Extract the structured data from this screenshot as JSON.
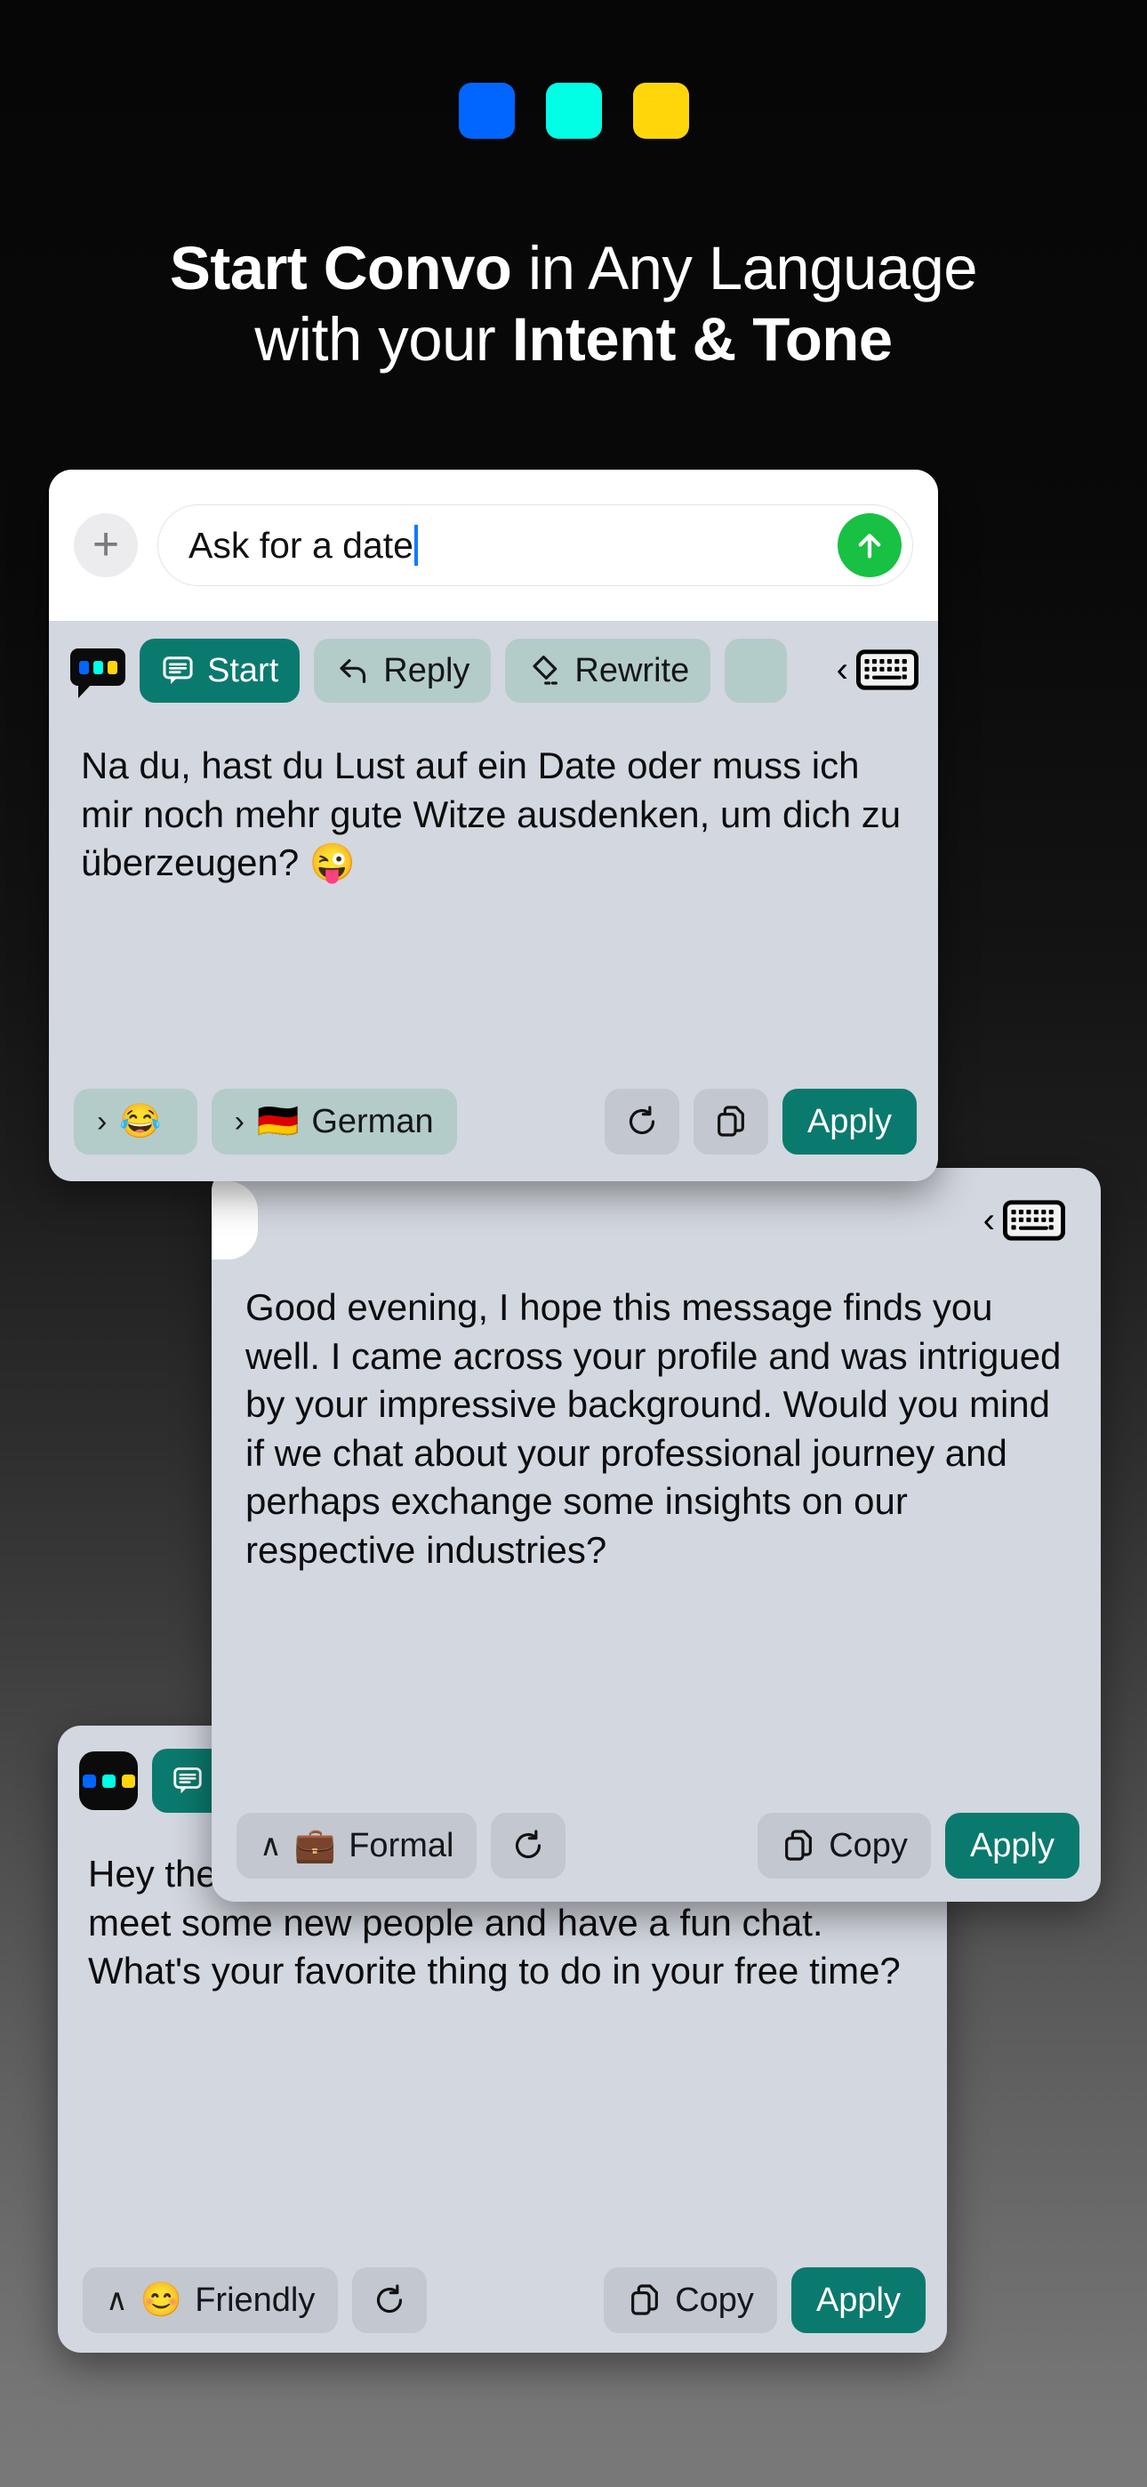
{
  "header": {
    "logo_squares": [
      {
        "name": "blue-square",
        "color": "#0066FF"
      },
      {
        "name": "cyan-square",
        "color": "#00FFE5"
      },
      {
        "name": "yellow-square",
        "color": "#FFD60A"
      }
    ],
    "headline_line1_bold": "Start Convo",
    "headline_line1_rest": " in Any Language",
    "headline_line2_pre": "with your ",
    "headline_line2_bold": "Intent & Tone"
  },
  "colors": {
    "accent_teal": "#0B7A6E",
    "chip_teal": "#B3CCC9",
    "chip_gray": "#C3C7CF",
    "card_bg": "#D3D7DF",
    "send_green": "#18C143",
    "caret_blue": "#0A7CFF"
  },
  "card1": {
    "input": {
      "add_label": "+",
      "value": "Ask for a date",
      "placeholder": "Ask for a date",
      "send_label": "Send"
    },
    "tabs": [
      {
        "label": "Start",
        "icon": "speech-bubble-lines-icon",
        "active": true
      },
      {
        "label": "Reply",
        "icon": "reply-arrow-icon",
        "active": false
      },
      {
        "label": "Rewrite",
        "icon": "pen-edit-icon",
        "active": false
      }
    ],
    "keyboard_dismiss": {
      "chevron": "‹",
      "icon": "keyboard-icon"
    },
    "message": "Na du, hast du Lust auf ein Date oder muss ich mir noch mehr gute Witze ausdenken, um dich zu überzeugen? 😜",
    "footer": {
      "tone_chevron": "›",
      "tone_emoji": "😂",
      "tone_label": "",
      "language_chevron": "›",
      "language_flag": "🇩🇪",
      "language_label": "German",
      "refresh_icon": "refresh-icon",
      "copy_icon": "copy-icon",
      "apply_label": "Apply"
    }
  },
  "card2": {
    "keyboard_dismiss": {
      "chevron": "‹",
      "icon": "keyboard-icon"
    },
    "message": "Good evening, I hope this message finds you well. I came across your profile and was intrigued by your impressive background. Would you mind if we chat about your professional journey and perhaps exchange some insights on our respective industries?",
    "footer": {
      "tone_chevron": "∧",
      "tone_emoji": "💼",
      "tone_label": "Formal",
      "refresh_icon": "refresh-icon",
      "copy_icon": "copy-icon",
      "copy_label": "Copy",
      "apply_label": "Apply"
    }
  },
  "card3": {
    "tabs": [
      {
        "label": "",
        "icon": "speech-bubble-lines-icon",
        "active": true
      }
    ],
    "message": "Hey there! How's your day going? Looking to meet some new people and have a fun chat. What's your favorite thing to do in your free time?",
    "footer": {
      "tone_chevron": "∧",
      "tone_emoji": "😊",
      "tone_label": "Friendly",
      "refresh_icon": "refresh-icon",
      "copy_icon": "copy-icon",
      "copy_label": "Copy",
      "apply_label": "Apply"
    }
  }
}
